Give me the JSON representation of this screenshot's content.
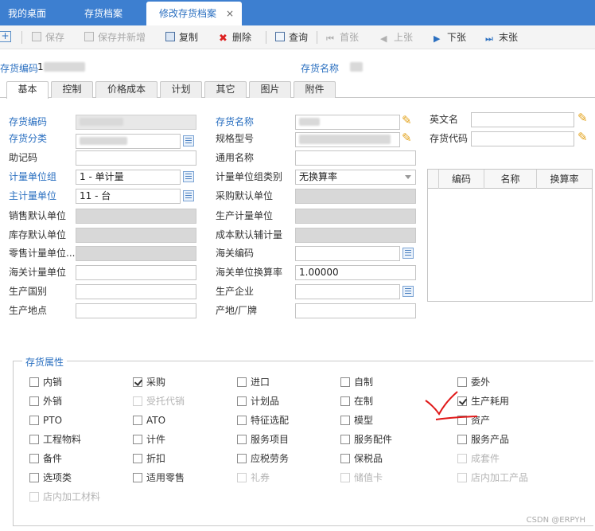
{
  "tabs": {
    "desk": "我的桌面",
    "archive": "存货档案",
    "edit": "修改存货档案",
    "close": "×"
  },
  "toolbar": {
    "save": "保存",
    "save_new": "保存并新增",
    "copy": "复制",
    "delete": "删除",
    "query": "查询",
    "first": "首张",
    "prev": "上张",
    "next": "下张",
    "last": "末张"
  },
  "header": {
    "code_label": "存货编码",
    "code_value": "1",
    "name_label": "存货名称"
  },
  "subtabs": [
    "基本",
    "控制",
    "价格成本",
    "计划",
    "其它",
    "图片",
    "附件"
  ],
  "form": {
    "col1": {
      "code": "存货编码",
      "category": "存货分类",
      "mnemonic": "助记码",
      "unit_group": "计量单位组",
      "unit_group_value": "1 - 单计量",
      "main_unit": "主计量单位",
      "main_unit_value": "11 - 台",
      "sales_unit": "销售默认单位",
      "stock_unit": "库存默认单位",
      "retail_unit": "零售计量单位...",
      "customs_unit": "海关计量单位",
      "origin_country": "生产国别",
      "origin_place": "生产地点"
    },
    "col2": {
      "name": "存货名称",
      "spec": "规格型号",
      "common_name": "通用名称",
      "unit_group_type": "计量单位组类别",
      "unit_group_type_value": "无换算率",
      "purchase_unit": "采购默认单位",
      "production_unit": "生产计量单位",
      "cost_unit": "成本默认辅计量",
      "customs_code": "海关编码",
      "customs_rate": "海关单位换算率",
      "customs_rate_value": "1.00000",
      "manufacturer": "生产企业",
      "brand": "产地/厂牌"
    },
    "col3": {
      "english_name": "英文名",
      "inv_code": "存货代码"
    }
  },
  "grid": {
    "headers": [
      "编码",
      "名称",
      "换算率"
    ]
  },
  "attributes": {
    "legend": "存货属性",
    "items": [
      {
        "label": "内销",
        "checked": false,
        "disabled": false
      },
      {
        "label": "采购",
        "checked": true,
        "disabled": false
      },
      {
        "label": "进口",
        "checked": false,
        "disabled": false
      },
      {
        "label": "自制",
        "checked": false,
        "disabled": false
      },
      {
        "label": "委外",
        "checked": false,
        "disabled": false
      },
      {
        "label": "外销",
        "checked": false,
        "disabled": false
      },
      {
        "label": "受托代销",
        "checked": false,
        "disabled": true
      },
      {
        "label": "计划品",
        "checked": false,
        "disabled": false
      },
      {
        "label": "在制",
        "checked": false,
        "disabled": false
      },
      {
        "label": "生产耗用",
        "checked": true,
        "disabled": false
      },
      {
        "label": "PTO",
        "checked": false,
        "disabled": false
      },
      {
        "label": "ATO",
        "checked": false,
        "disabled": false
      },
      {
        "label": "特征选配",
        "checked": false,
        "disabled": false
      },
      {
        "label": "模型",
        "checked": false,
        "disabled": false
      },
      {
        "label": "资产",
        "checked": false,
        "disabled": false
      },
      {
        "label": "工程物料",
        "checked": false,
        "disabled": false
      },
      {
        "label": "计件",
        "checked": false,
        "disabled": false
      },
      {
        "label": "服务项目",
        "checked": false,
        "disabled": false
      },
      {
        "label": "服务配件",
        "checked": false,
        "disabled": false
      },
      {
        "label": "服务产品",
        "checked": false,
        "disabled": false
      },
      {
        "label": "备件",
        "checked": false,
        "disabled": false
      },
      {
        "label": "折扣",
        "checked": false,
        "disabled": false
      },
      {
        "label": "应税劳务",
        "checked": false,
        "disabled": false
      },
      {
        "label": "保税品",
        "checked": false,
        "disabled": false
      },
      {
        "label": "成套件",
        "checked": false,
        "disabled": true
      },
      {
        "label": "选项类",
        "checked": false,
        "disabled": false
      },
      {
        "label": "适用零售",
        "checked": false,
        "disabled": false
      },
      {
        "label": "礼券",
        "checked": false,
        "disabled": true
      },
      {
        "label": "储值卡",
        "checked": false,
        "disabled": true
      },
      {
        "label": "店内加工产品",
        "checked": false,
        "disabled": true
      },
      {
        "label": "店内加工材料",
        "checked": false,
        "disabled": true
      }
    ]
  },
  "watermark": "CSDN @ERPYH"
}
